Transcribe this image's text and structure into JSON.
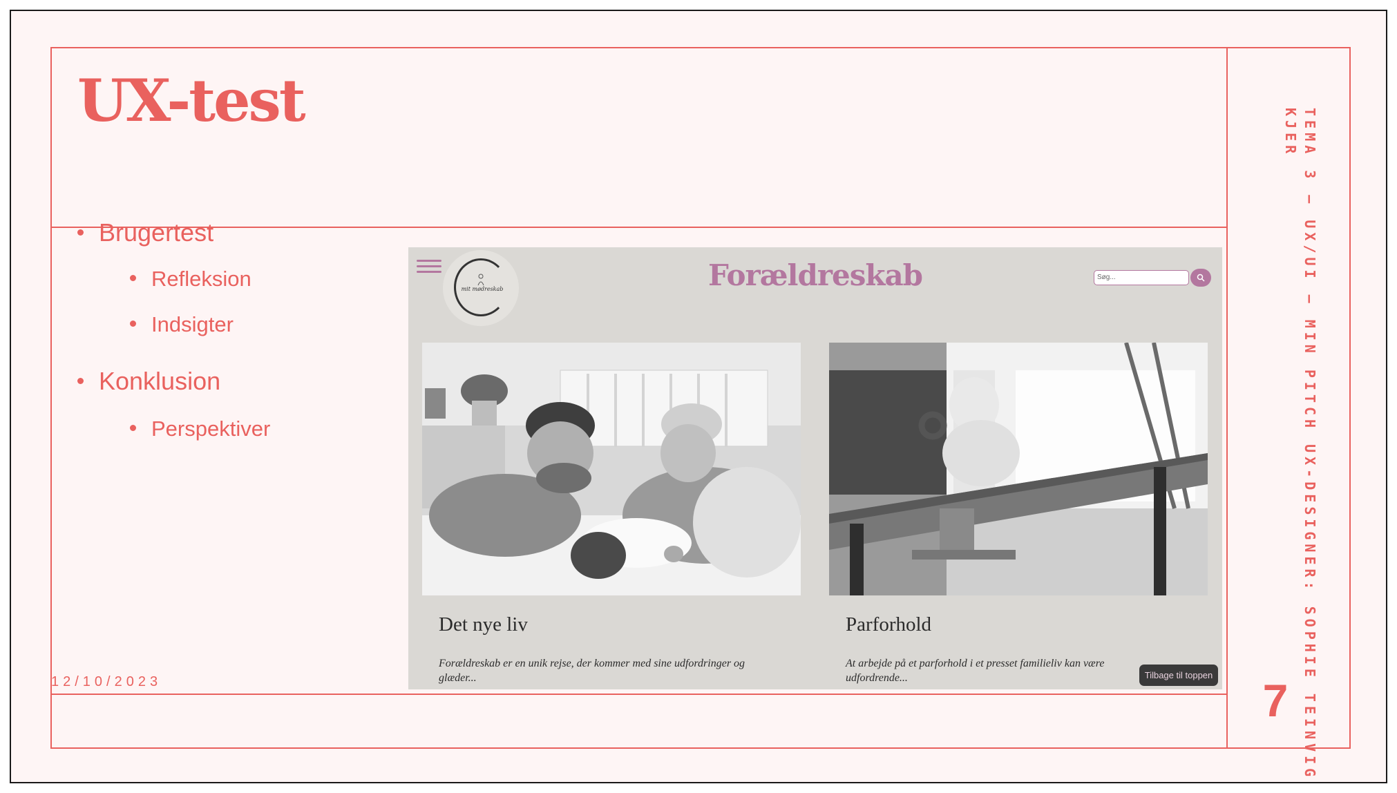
{
  "slide": {
    "title": "UX-test",
    "date": "12/10/2023",
    "sidebar_text": "TEMA 3 – UX/UI – MIN PITCH UX-DESIGNER: SOPHIE TEINVIG KJER",
    "page_number": "7",
    "bullets": [
      {
        "label": "Brugertest",
        "sub": [
          "Refleksion",
          "Indsigter"
        ]
      },
      {
        "label": "Konklusion",
        "sub": [
          "Perspektiver"
        ]
      }
    ],
    "accent_color": "#e9615e"
  },
  "site": {
    "title": "Forældreskab",
    "logo_text": "mit mødreskab",
    "search_placeholder": "Søg...",
    "back_to_top": "Tilbage til toppen",
    "brand_color": "#b3779f",
    "cards": [
      {
        "title": "Det nye liv",
        "text_line1": "Forældreskab er en unik rejse, der kommer med sine udfordringer og",
        "text_line2": "glæder..."
      },
      {
        "title": "Parforhold",
        "text_line1": "At arbejde på et parforhold i et presset familieliv kan være",
        "text_line2": "udfordrende..."
      }
    ]
  }
}
